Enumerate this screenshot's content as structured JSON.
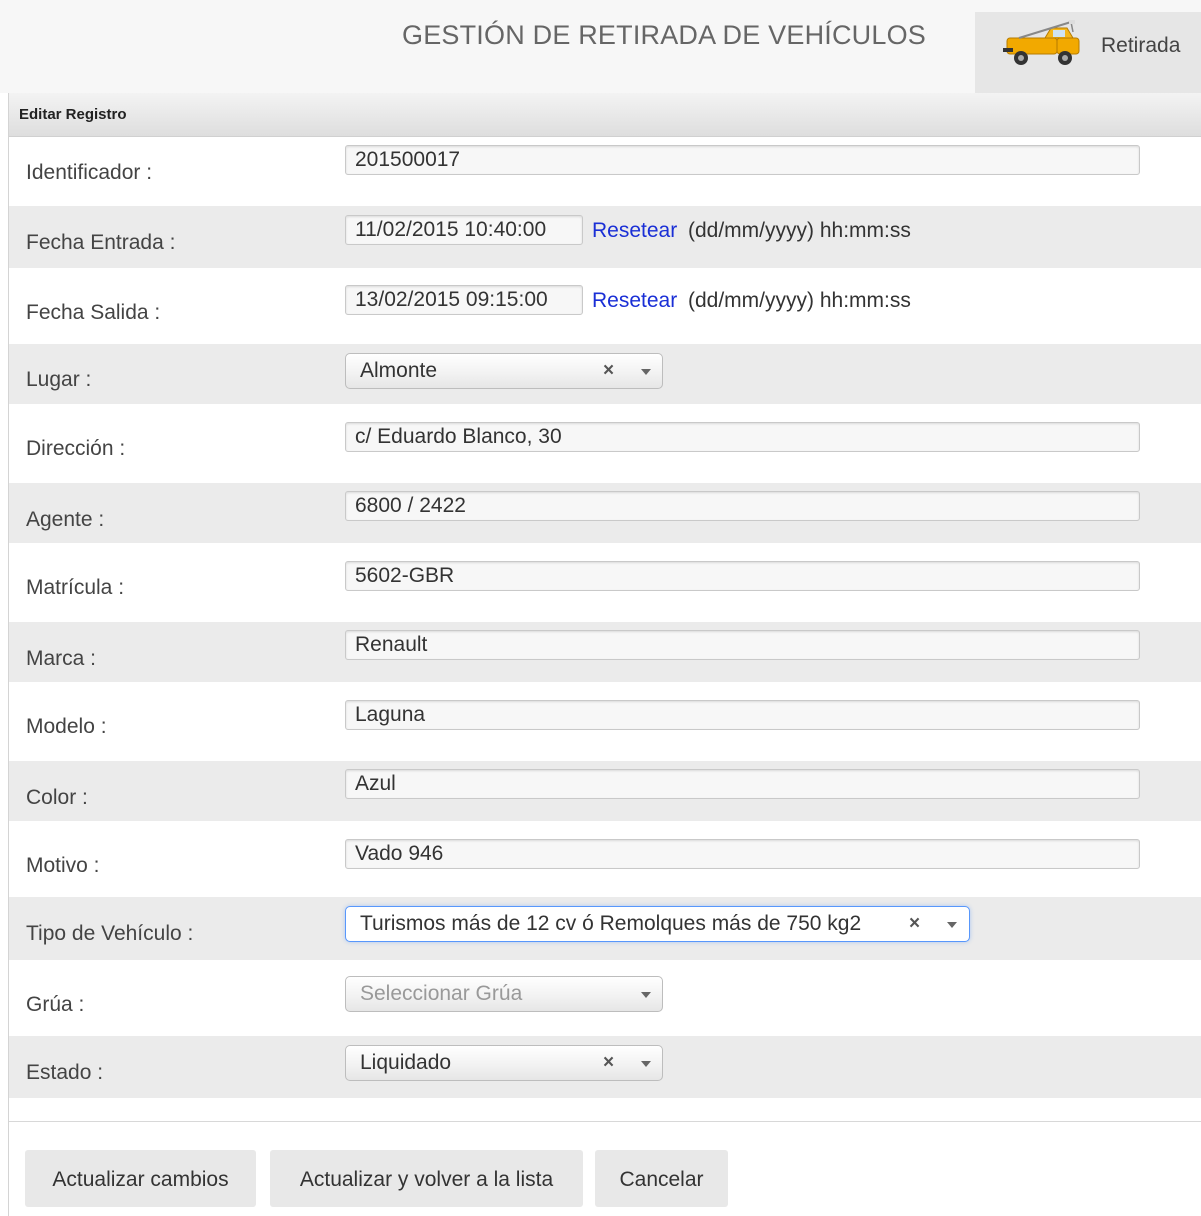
{
  "header": {
    "title": "GESTIÓN DE RETIRADA DE VEHÍCULOS",
    "module_tab": {
      "label": "Retirada",
      "icon": "tow-truck-icon"
    }
  },
  "panel": {
    "title": "Editar Registro"
  },
  "form": {
    "identificador": {
      "label": "Identificador :",
      "value": "201500017"
    },
    "fecha_entrada": {
      "label": "Fecha Entrada :",
      "value": "11/02/2015 10:40:00",
      "reset": "Resetear",
      "hint": "(dd/mm/yyyy) hh:mm:ss"
    },
    "fecha_salida": {
      "label": "Fecha Salida :",
      "value": "13/02/2015 09:15:00",
      "reset": "Resetear",
      "hint": "(dd/mm/yyyy) hh:mm:ss"
    },
    "lugar": {
      "label": "Lugar :",
      "value": "Almonte",
      "clear": "×"
    },
    "direccion": {
      "label": "Dirección :",
      "value": "c/ Eduardo Blanco, 30"
    },
    "agente": {
      "label": "Agente :",
      "value": "6800 / 2422"
    },
    "matricula": {
      "label": "Matrícula :",
      "value": "5602-GBR"
    },
    "marca": {
      "label": "Marca :",
      "value": "Renault"
    },
    "modelo": {
      "label": "Modelo :",
      "value": "Laguna"
    },
    "color": {
      "label": "Color :",
      "value": "Azul"
    },
    "motivo": {
      "label": "Motivo :",
      "value": "Vado 946"
    },
    "tipo_vehiculo": {
      "label": "Tipo de Vehículo :",
      "value": "Turismos más de 12 cv ó Remolques más de 750 kg2",
      "clear": "×"
    },
    "grua": {
      "label": "Grúa :",
      "placeholder": "Seleccionar Grúa"
    },
    "estado": {
      "label": "Estado :",
      "value": "Liquidado",
      "clear": "×"
    }
  },
  "actions": {
    "update": "Actualizar cambios",
    "update_return": "Actualizar y volver a la lista",
    "cancel": "Cancelar"
  },
  "colors": {
    "link": "#1a2fd6",
    "row_alt": "#ebebeb",
    "focus": "#5897fb",
    "button_bg": "#e8e8e8"
  }
}
